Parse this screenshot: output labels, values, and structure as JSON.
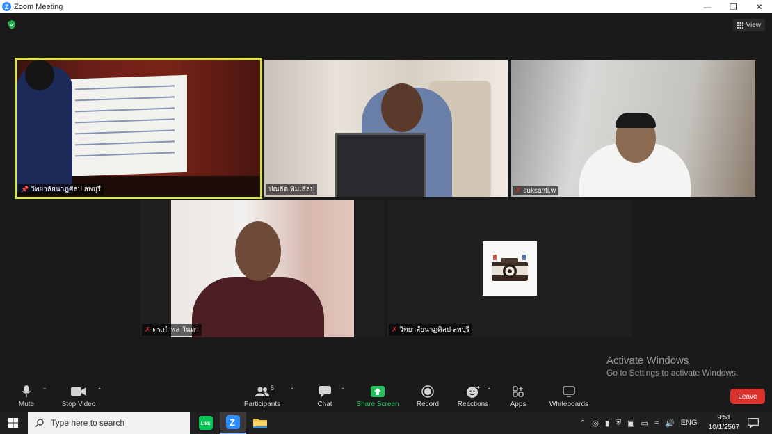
{
  "window": {
    "title": "Zoom Meeting",
    "controls": [
      "minimize",
      "restore",
      "close"
    ]
  },
  "meeting": {
    "view_label": "View",
    "participants": [
      {
        "name": "วิทยาลัยนาฏศิลป ลพบุรี",
        "pinned": true,
        "muted": false
      },
      {
        "name": "ปณธิด ทิมเสิลป",
        "pinned": false,
        "muted": false
      },
      {
        "name": "suksanti.w",
        "pinned": false,
        "muted": true
      },
      {
        "name": "ดร.กำพล วันทา",
        "pinned": false,
        "muted": true
      },
      {
        "name": "วิทยาลัยนาฏศิลป ลพบุรี",
        "pinned": false,
        "muted": true
      }
    ],
    "active_speaker_color": "#d9e34a"
  },
  "toolbar": {
    "mute": "Mute",
    "stop_video": "Stop Video",
    "participants": "Participants",
    "participants_count": "5",
    "chat": "Chat",
    "share_screen": "Share Screen",
    "record": "Record",
    "reactions": "Reactions",
    "apps": "Apps",
    "whiteboards": "Whiteboards",
    "leave": "Leave",
    "share_color": "#20c05c",
    "leave_color": "#d9322e"
  },
  "watermark": {
    "line1": "Activate Windows",
    "line2": "Go to Settings to activate Windows."
  },
  "taskbar": {
    "search_placeholder": "Type here to search",
    "language": "ENG",
    "time": "9:51",
    "date": "10/1/2567"
  }
}
